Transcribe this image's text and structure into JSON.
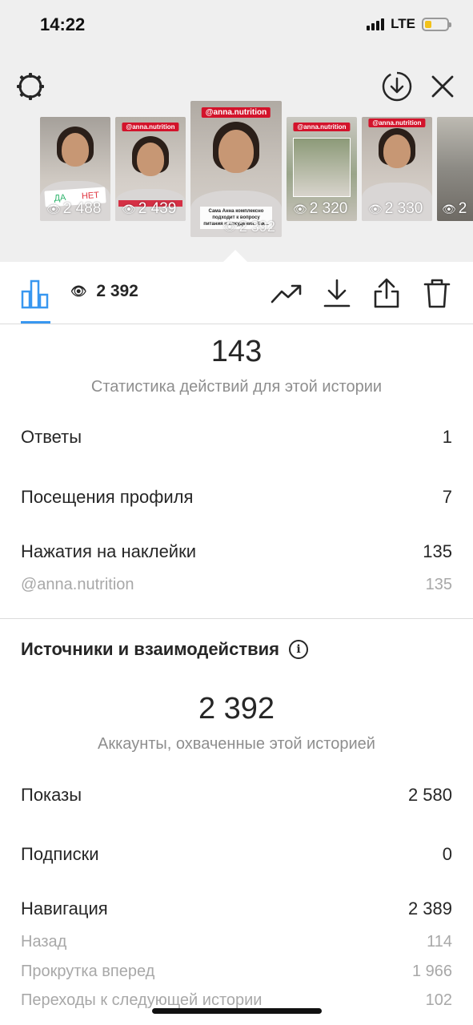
{
  "status_bar": {
    "time": "14:22",
    "network": "LTE"
  },
  "stories": [
    {
      "views": "2 488",
      "poll_yes": "ДА",
      "poll_no": "НЕТ"
    },
    {
      "views": "2 439",
      "tag": "@anna.nutrition"
    },
    {
      "views": "2 392",
      "tag": "@anna.nutrition",
      "caption": "Сама Анна комплексно подходит к вопросу питания и похудения. Как..."
    },
    {
      "views": "2 320",
      "tag": "@anna.nutrition"
    },
    {
      "views": "2 330",
      "tag": "@anna.nutrition"
    },
    {
      "views": "2"
    }
  ],
  "toolbar": {
    "views": "2 392"
  },
  "actions": {
    "total": "143",
    "subtitle": "Статистика действий для этой истории",
    "replies_label": "Ответы",
    "replies_value": "1",
    "profile_visits_label": "Посещения профиля",
    "profile_visits_value": "7",
    "sticker_taps_label": "Нажатия на наклейки",
    "sticker_taps_value": "135",
    "sticker_handle_label": "@anna.nutrition",
    "sticker_handle_value": "135"
  },
  "discovery": {
    "title": "Источники и взаимодействия",
    "reach": "2 392",
    "reach_subtitle": "Аккаунты, охваченные этой историей",
    "impressions_label": "Показы",
    "impressions_value": "2 580",
    "follows_label": "Подписки",
    "follows_value": "0",
    "navigation_label": "Навигация",
    "navigation_value": "2 389",
    "back_label": "Назад",
    "back_value": "114",
    "forward_label": "Прокрутка вперед",
    "forward_value": "1 966",
    "next_story_label": "Переходы к следующей истории",
    "next_story_value": "102"
  },
  "colors": {
    "accent": "#3897f0",
    "tag_red": "#d3132b",
    "text": "#262626",
    "muted": "#8e8e8e"
  },
  "icons": [
    "settings-icon",
    "download-circle-icon",
    "close-icon",
    "bar-chart-icon",
    "eye-icon",
    "trending-icon",
    "download-icon",
    "share-icon",
    "trash-icon",
    "info-icon"
  ]
}
